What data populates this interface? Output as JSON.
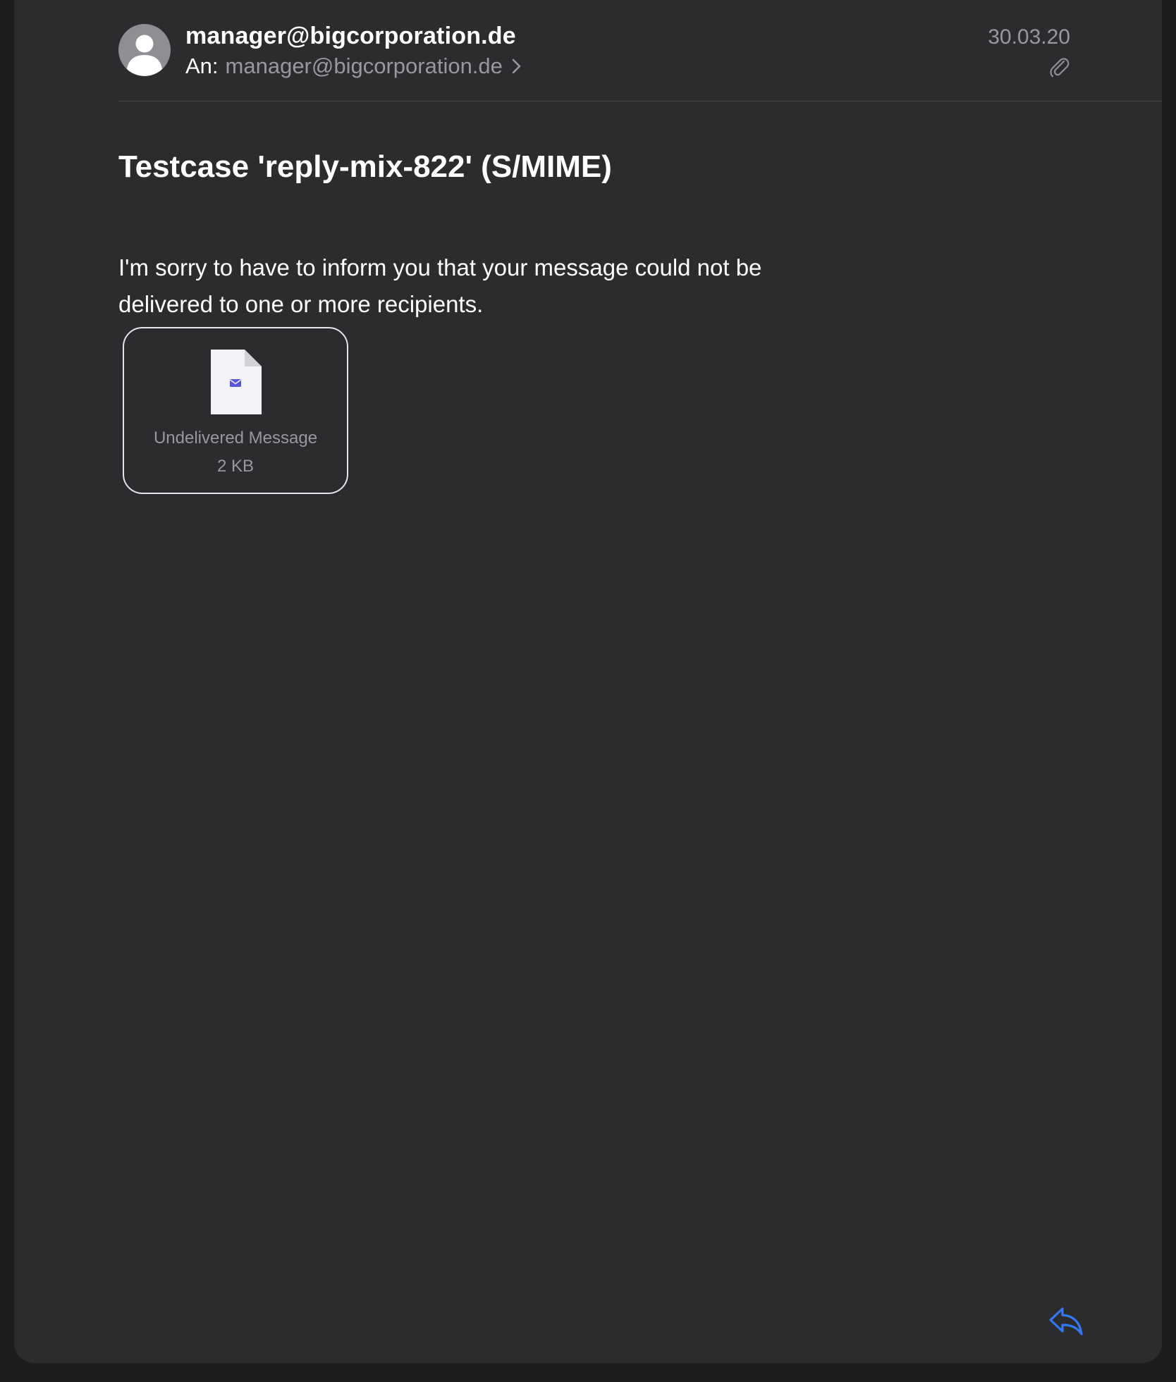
{
  "message": {
    "from": "manager@bigcorporation.de",
    "to_label": "An:",
    "to_address": "manager@bigcorporation.de",
    "date": "30.03.20",
    "subject": "Testcase 'reply-mix-822' (S/MIME)",
    "body": "I'm sorry to have to inform you that your message could not be delivered to one or more recipients."
  },
  "attachment": {
    "name": "Undelivered Message",
    "size": "2 KB",
    "icon": "mail-document-icon"
  },
  "icons": {
    "avatar": "person-silhouette-icon",
    "recipient_chevron": "chevron-right-icon",
    "attachment_indicator": "paperclip-icon",
    "reply": "reply-arrow-icon"
  },
  "colors": {
    "background": "#1c1c1e",
    "sheet": "#2c2c2e",
    "secondary_text": "#98989d",
    "accent": "#3478f6"
  }
}
